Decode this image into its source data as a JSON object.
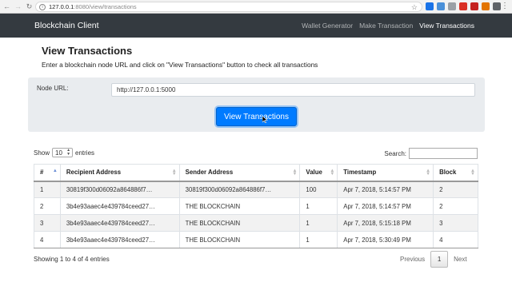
{
  "browser": {
    "url_host": "127.0.0.1",
    "url_path": ":8080/view/transactions"
  },
  "navbar": {
    "brand": "Blockchain Client",
    "links": [
      {
        "label": "Wallet Generator",
        "active": false
      },
      {
        "label": "Make Transaction",
        "active": false
      },
      {
        "label": "View Transactions",
        "active": true
      }
    ]
  },
  "page": {
    "title": "View Transactions",
    "description": "Enter a blockchain node URL and click on \"View Transactions\" button to check all transactions"
  },
  "form": {
    "node_url_label": "Node URL:",
    "node_url_value": "http://127.0.0.1:5000",
    "button_label": "View Transactions"
  },
  "table_controls": {
    "show_label": "Show",
    "entries_value": "10",
    "entries_label": "entries",
    "search_label": "Search:"
  },
  "table": {
    "headers": [
      "#",
      "Recipient Address",
      "Sender Address",
      "Value",
      "Timestamp",
      "Block"
    ],
    "rows": [
      [
        "1",
        "30819f300d06092a864886f7…",
        "30819f300d06092a864886f7…",
        "100",
        "Apr 7, 2018, 5:14:57 PM",
        "2"
      ],
      [
        "2",
        "3b4e93aaec4e439784ceed27…",
        "THE BLOCKCHAIN",
        "1",
        "Apr 7, 2018, 5:14:57 PM",
        "2"
      ],
      [
        "3",
        "3b4e93aaec4e439784ceed27…",
        "THE BLOCKCHAIN",
        "1",
        "Apr 7, 2018, 5:15:18 PM",
        "3"
      ],
      [
        "4",
        "3b4e93aaec4e439784ceed27…",
        "THE BLOCKCHAIN",
        "1",
        "Apr 7, 2018, 5:30:49 PM",
        "4"
      ]
    ]
  },
  "footer": {
    "info": "Showing 1 to 4 of 4 entries",
    "previous": "Previous",
    "current_page": "1",
    "next": "Next"
  },
  "colors": {
    "navbar_bg": "#343a40",
    "primary_button": "#007bff",
    "form_panel": "#e9ecef"
  }
}
